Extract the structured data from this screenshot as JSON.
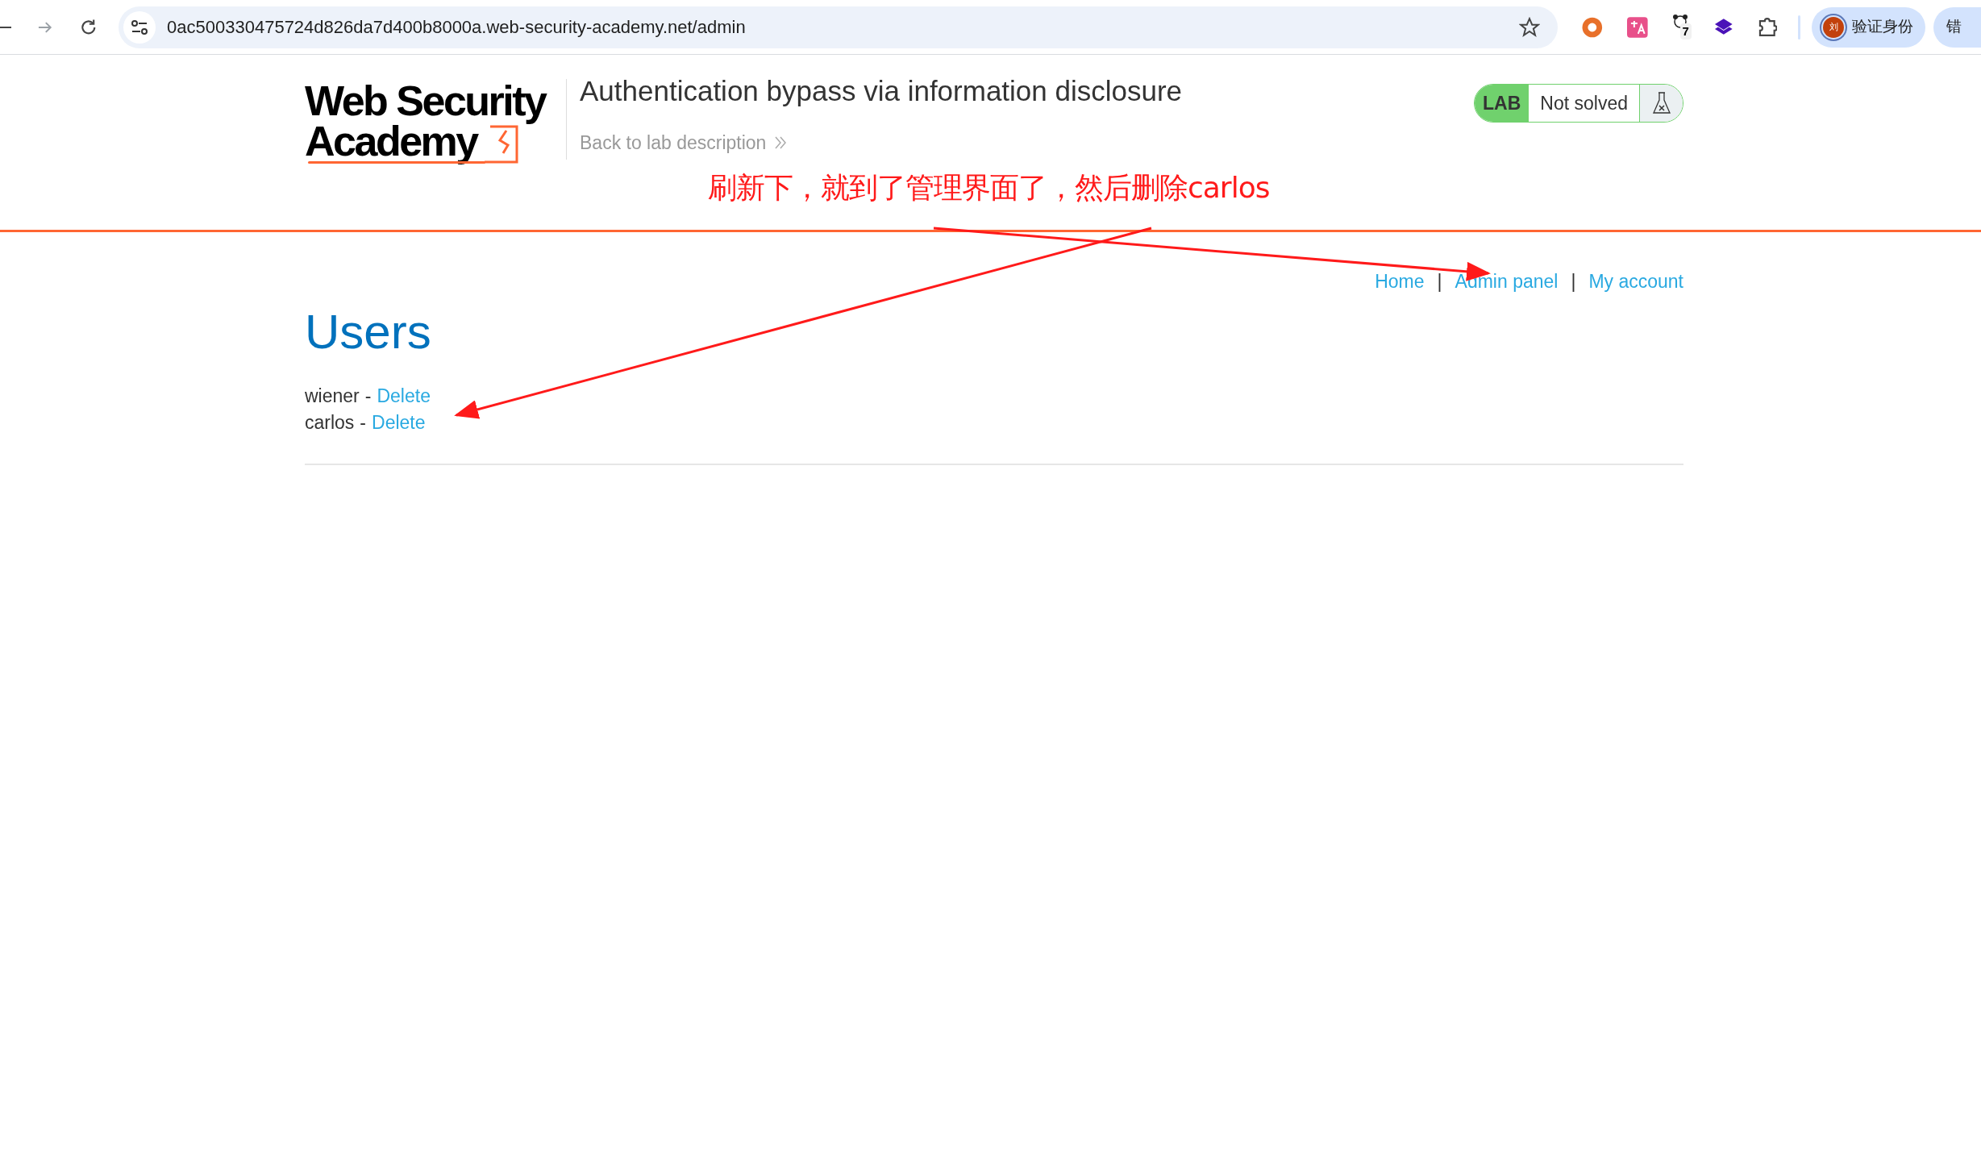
{
  "browser": {
    "url": "0ac500330475724d826da7d400b8000a.web-security-academy.net/admin",
    "extension_badge": "7",
    "avatar_text": "刘",
    "profile_label": "验证身份",
    "cut_pill_text": "错"
  },
  "header": {
    "logo_lines": [
      "Web Security",
      "Academy"
    ],
    "title": "Authentication bypass via information disclosure",
    "back_link": "Back to lab description",
    "lab": {
      "label": "LAB",
      "status": "Not solved",
      "solved": false
    }
  },
  "annotation": {
    "text": "刷新下，就到了管理界面了，然后删除carlos"
  },
  "nav": [
    {
      "kind": "link",
      "label": "Home"
    },
    {
      "kind": "separator",
      "label": "|"
    },
    {
      "kind": "link",
      "label": "Admin panel"
    },
    {
      "kind": "separator",
      "label": "|"
    },
    {
      "kind": "link",
      "label": "My account"
    }
  ],
  "users": {
    "heading": "Users",
    "rows": [
      {
        "name": "wiener",
        "separator": "-",
        "action": "Delete"
      },
      {
        "name": "carlos",
        "separator": "-",
        "action": "Delete"
      }
    ]
  }
}
